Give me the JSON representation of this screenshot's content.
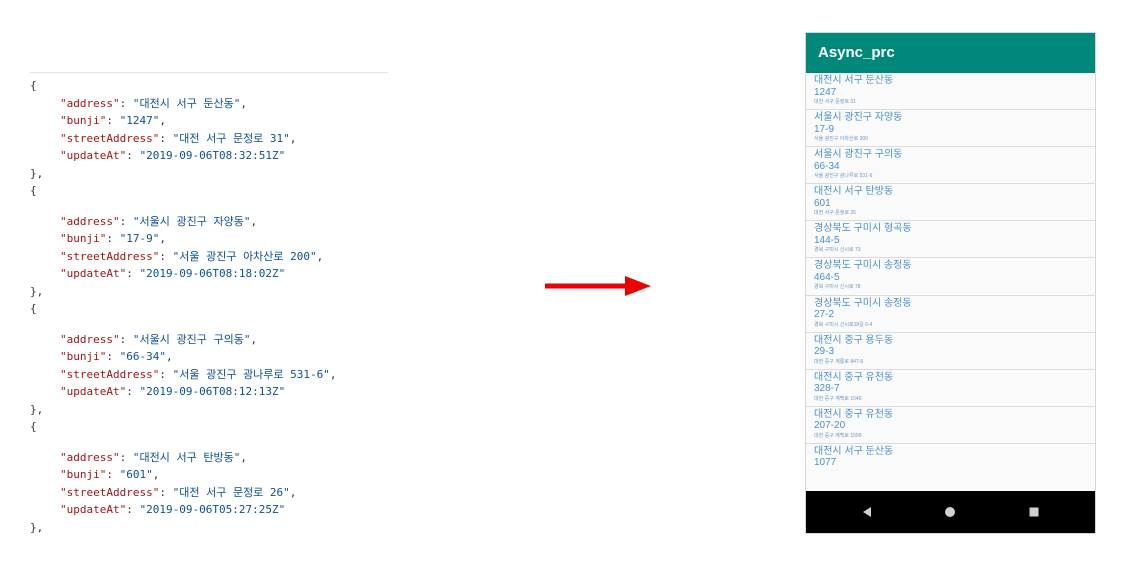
{
  "code": {
    "records": [
      {
        "address": "대전시 서구 둔산동",
        "bunji": "1247",
        "streetAddress": "대전 서구 문정로 31",
        "updateAt": "2019-09-06T08:32:51Z"
      },
      {
        "address": "서울시 광진구 자양동",
        "bunji": "17-9",
        "streetAddress": "서울 광진구 아차산로 200",
        "updateAt": "2019-09-06T08:18:02Z"
      },
      {
        "address": "서울시 광진구 구의동",
        "bunji": "66-34",
        "streetAddress": "서울 광진구 광나루로 531-6",
        "updateAt": "2019-09-06T08:12:13Z"
      },
      {
        "address": "대전시 서구 탄방동",
        "bunji": "601",
        "streetAddress": "대전 서구 문정로 26",
        "updateAt": "2019-09-06T05:27:25Z"
      }
    ]
  },
  "arrow": {
    "color": "#ee0000"
  },
  "app": {
    "title": "Async_prc",
    "appbar_color": "#00897b",
    "text_color": "#4a8fd4",
    "items": [
      {
        "address": "대전시 서구 둔산동",
        "bunji": "1247",
        "street": "대전 서구 문정로 31"
      },
      {
        "address": "서울시 광진구 자양동",
        "bunji": "17-9",
        "street": "서울 광진구 아차산로 200"
      },
      {
        "address": "서울시 광진구 구의동",
        "bunji": "66-34",
        "street": "서울 광진구 광나루로 531-6"
      },
      {
        "address": "대전시 서구 탄방동",
        "bunji": "601",
        "street": "대전 서구 문정로 26"
      },
      {
        "address": "경상북도 구미시 형곡동",
        "bunji": "144-5",
        "street": "경북 구미시 신시로 73"
      },
      {
        "address": "경상북도 구미시 송정동",
        "bunji": "464-5",
        "street": "경북 구미시 신시로 78"
      },
      {
        "address": "경상북도 구미시 송정동",
        "bunji": "27-2",
        "street": "경북 구미시 신시로18길 6-4"
      },
      {
        "address": "대전시 중구 용두동",
        "bunji": "29-3",
        "street": "대전 중구 계룡로 847-6"
      },
      {
        "address": "대전시 중구 유천동",
        "bunji": "328-7",
        "street": "대전 중구 계백로 1546"
      },
      {
        "address": "대전시 중구 유천동",
        "bunji": "207-20",
        "street": "대전 중구 계백로 1599"
      },
      {
        "address": "대전시 서구 둔산동",
        "bunji": "1077",
        "street": ""
      }
    ],
    "nav": {
      "back_icon": "back-triangle-icon",
      "home_icon": "home-circle-icon",
      "recent_icon": "recent-square-icon"
    }
  }
}
